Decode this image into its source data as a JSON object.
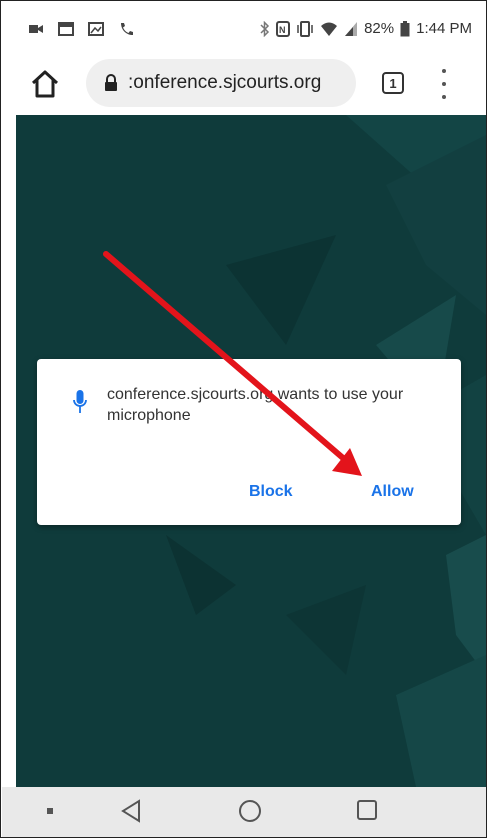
{
  "status_bar": {
    "battery_percent": "82%",
    "time": "1:44 PM",
    "left_icons": [
      "video-icon",
      "image-icon",
      "photo-icon",
      "call-icon"
    ],
    "right_icons": [
      "bluetooth-icon",
      "nfc-icon",
      "vibrate-icon",
      "wifi-icon",
      "signal-icon",
      "battery-icon"
    ]
  },
  "browser": {
    "url": ":onference.sjcourts.org",
    "tab_count": "1"
  },
  "permission_dialog": {
    "message": "conference.sjcourts.org wants to use your microphone",
    "block_label": "Block",
    "allow_label": "Allow"
  },
  "colors": {
    "page_background": "#0f3b3b",
    "button_blue": "#1a73e8",
    "arrow_red": "#e3141b",
    "mic_blue": "#1a73e8"
  },
  "nav_bar": {
    "icons": [
      "square-small-icon",
      "back-icon",
      "home-circle-icon",
      "recents-icon"
    ]
  }
}
